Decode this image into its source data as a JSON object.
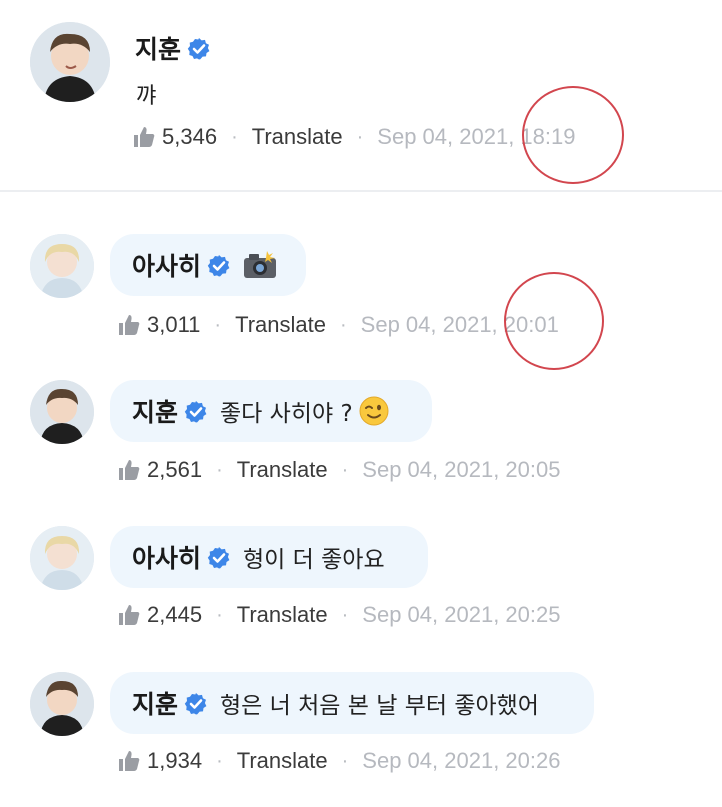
{
  "colors": {
    "bubble_bg": "#eef6fd",
    "verified_blue": "#3d86e8",
    "timestamp_gray": "#b6b9bf",
    "annotation_red": "#d2464e"
  },
  "icons": {
    "verified": "verified-badge-icon",
    "like": "thumbs-up-icon",
    "camera": "camera-flash-emoji",
    "wink": "winking-face-emoji"
  },
  "post": {
    "author": "지훈",
    "text": "꺄",
    "likes": "5,346",
    "translate": "Translate",
    "separator": "·",
    "timestamp": "Sep 04, 2021, 18:19"
  },
  "comments": [
    {
      "author": "아사히",
      "text": "",
      "likes": "3,011",
      "translate": "Translate",
      "timestamp": "Sep 04, 2021, 20:01"
    },
    {
      "author": "지훈",
      "text": "좋다 사히야 ?",
      "likes": "2,561",
      "translate": "Translate",
      "timestamp": "Sep 04, 2021, 20:05"
    },
    {
      "author": "아사히",
      "text": "형이 더 좋아요",
      "likes": "2,445",
      "translate": "Translate",
      "timestamp": "Sep 04, 2021, 20:25"
    },
    {
      "author": "지훈",
      "text": "형은 너 처음 본 날 부터 좋아했어",
      "likes": "1,934",
      "translate": "Translate",
      "timestamp": "Sep 04, 2021, 20:26"
    }
  ]
}
